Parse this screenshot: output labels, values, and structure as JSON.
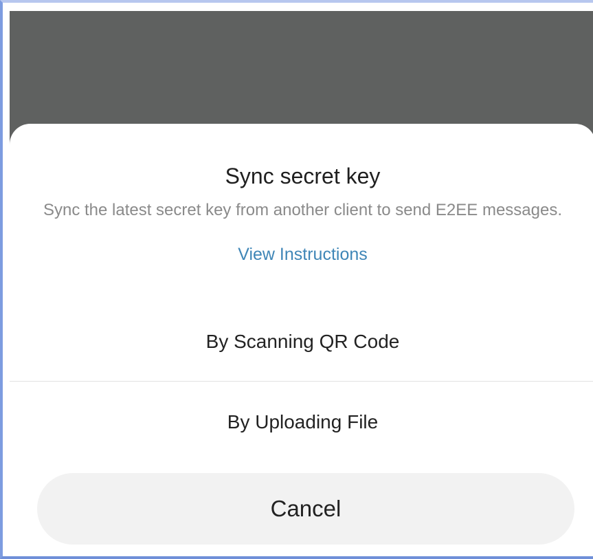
{
  "dialog": {
    "title": "Sync secret key",
    "description": "Sync the latest secret key from another client to send E2EE messages.",
    "instructions_link": "View Instructions",
    "options": [
      {
        "label": "By Scanning QR Code"
      },
      {
        "label": "By Uploading File"
      }
    ],
    "cancel_label": "Cancel"
  },
  "colors": {
    "backdrop": "#5f6160",
    "link": "#3f86b7",
    "muted_text": "#8a8a8a",
    "cancel_bg": "#f2f2f2"
  }
}
